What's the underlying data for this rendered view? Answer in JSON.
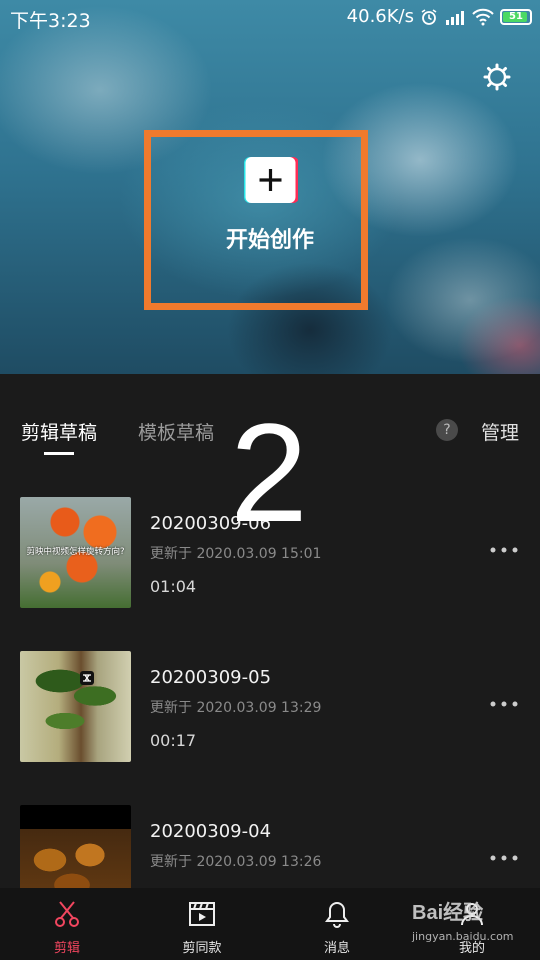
{
  "status_bar": {
    "time": "下午3:23",
    "speed": "40.6K/s",
    "battery": "51"
  },
  "hero": {
    "create_label": "开始创作",
    "settings_icon": "settings-icon",
    "create_icon": "plus-icon"
  },
  "annotation": {
    "number": "2"
  },
  "tabs": {
    "active": "剪辑草稿",
    "inactive": "模板草稿",
    "help": "?",
    "manage": "管理"
  },
  "drafts": [
    {
      "title": "20200309-06",
      "updated": "更新于 2020.03.09 15:01",
      "duration": "01:04",
      "thumb_caption": "剪映中视频怎样旋转方向?"
    },
    {
      "title": "20200309-05",
      "updated": "更新于 2020.03.09 13:29",
      "duration": "00:17"
    },
    {
      "title": "20200309-04",
      "updated": "更新于 2020.03.09 13:26"
    }
  ],
  "bottom_nav": [
    {
      "label": "剪辑",
      "icon": "scissors-icon",
      "active": true
    },
    {
      "label": "剪同款",
      "icon": "clapperboard-icon",
      "active": false
    },
    {
      "label": "消息",
      "icon": "bell-icon",
      "active": false
    },
    {
      "label": "我的",
      "icon": "profile-icon",
      "active": false
    }
  ],
  "watermark": {
    "text": "Bai经验",
    "sub": "jingyan.baidu.com"
  },
  "colors": {
    "accent": "#f2465f",
    "frame": "#f07a2d",
    "background": "#1b1b1b"
  }
}
